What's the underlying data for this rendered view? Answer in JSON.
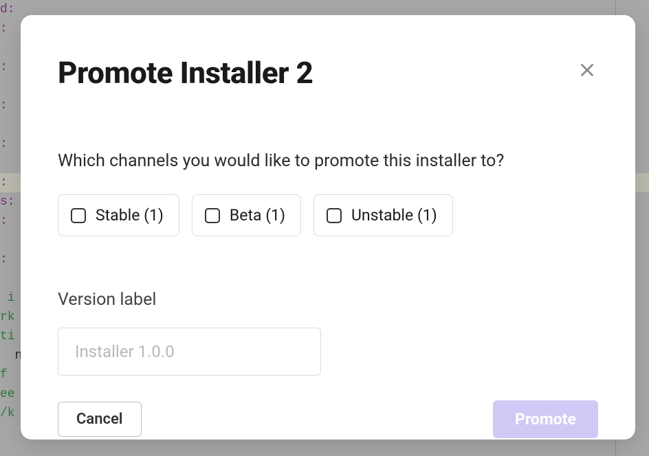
{
  "code_fragments": {
    "l0": "d:",
    "l1": ":",
    "l3": ":",
    "l5": ":",
    "l7": ":",
    "l9": ":",
    "l10": "s:",
    "l11": ":",
    "l13": ":",
    "l15": " i",
    "l16": "rk",
    "l17": "ti",
    "l18": "  n",
    "l19": "f",
    "l20": "ee",
    "l21": "/k"
  },
  "modal": {
    "title": "Promote Installer 2",
    "prompt": "Which channels you would like to promote this installer to?",
    "channels": [
      {
        "label": "Stable (1)"
      },
      {
        "label": "Beta (1)"
      },
      {
        "label": "Unstable (1)"
      }
    ],
    "version_label": "Version label",
    "version_placeholder": "Installer 1.0.0",
    "cancel_label": "Cancel",
    "promote_label": "Promote"
  }
}
